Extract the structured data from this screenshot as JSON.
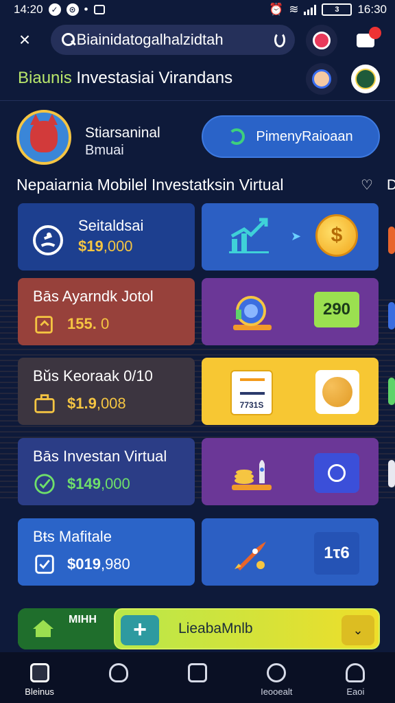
{
  "status_bar": {
    "time_left": "14:20",
    "time_right": "16:30",
    "battery": "3"
  },
  "search": {
    "value": "Biainidatogalhalzidtah"
  },
  "cart": {
    "badge": ""
  },
  "header": {
    "title_accent": "Biaunis",
    "title_rest": " Investasiai Virandans"
  },
  "user": {
    "name": "Stiarsaninal",
    "subtitle": "Bmuai",
    "cta_label": "PimenyRaioaan"
  },
  "section": {
    "title": "Nepaiarnia Mobilel Investatksin Virtual",
    "more": "D"
  },
  "cards_left": [
    {
      "title": "Seitaldsai",
      "value": "$19",
      "value_rest": ",000",
      "icon": "user-badge-icon",
      "value_color": "#f5c542"
    },
    {
      "title": "Bās  Ayarndk Jotol",
      "value": "155.",
      "value_rest": " 0",
      "icon": "tag-icon",
      "value_color": "#f5c542"
    },
    {
      "title": "Bŭs  Keoraak 0/10",
      "value": "$1.9",
      "value_rest": ",008",
      "icon": "briefcase-icon",
      "value_color": "#f5c542"
    },
    {
      "title": "Bās  Investan Virtual",
      "value": "$149",
      "value_rest": ",000",
      "icon": "check-circle-icon",
      "value_color": "#6fe06a"
    },
    {
      "title": "Bŧs  Mafitale",
      "value": "$019",
      "value_rest": ",980",
      "icon": "check-square-icon",
      "value_color": "#ffffff"
    }
  ],
  "cards_right": [
    {
      "badge": "",
      "icon": "growth-chart-icon",
      "icon2": "dollar-coin-icon"
    },
    {
      "badge": "290",
      "icon": "robot-illustration-icon",
      "badge_bg": "#9be050",
      "badge_color": "#1b3b1a"
    },
    {
      "badge": "7731S",
      "icon": "document-icon",
      "icon2": "cookie-icon"
    },
    {
      "badge": "",
      "icon": "coins-rocket-icon",
      "icon2": "clock-icon"
    },
    {
      "badge": "1τ6",
      "icon": "rocket-icon"
    }
  ],
  "action_bar": {
    "left_label": "MIHH",
    "plus": "+",
    "label": "LieabaMnlb",
    "chevron": "⌄"
  },
  "bottom_nav": [
    {
      "label": "Bleinus",
      "icon": "home-icon",
      "active": true
    },
    {
      "label": "",
      "icon": "heart-icon",
      "active": false
    },
    {
      "label": "",
      "icon": "square-icon",
      "active": false
    },
    {
      "label": "Ieooealt",
      "icon": "compass-icon",
      "active": false
    },
    {
      "label": "Eaoi",
      "icon": "profile-icon",
      "active": false
    }
  ]
}
